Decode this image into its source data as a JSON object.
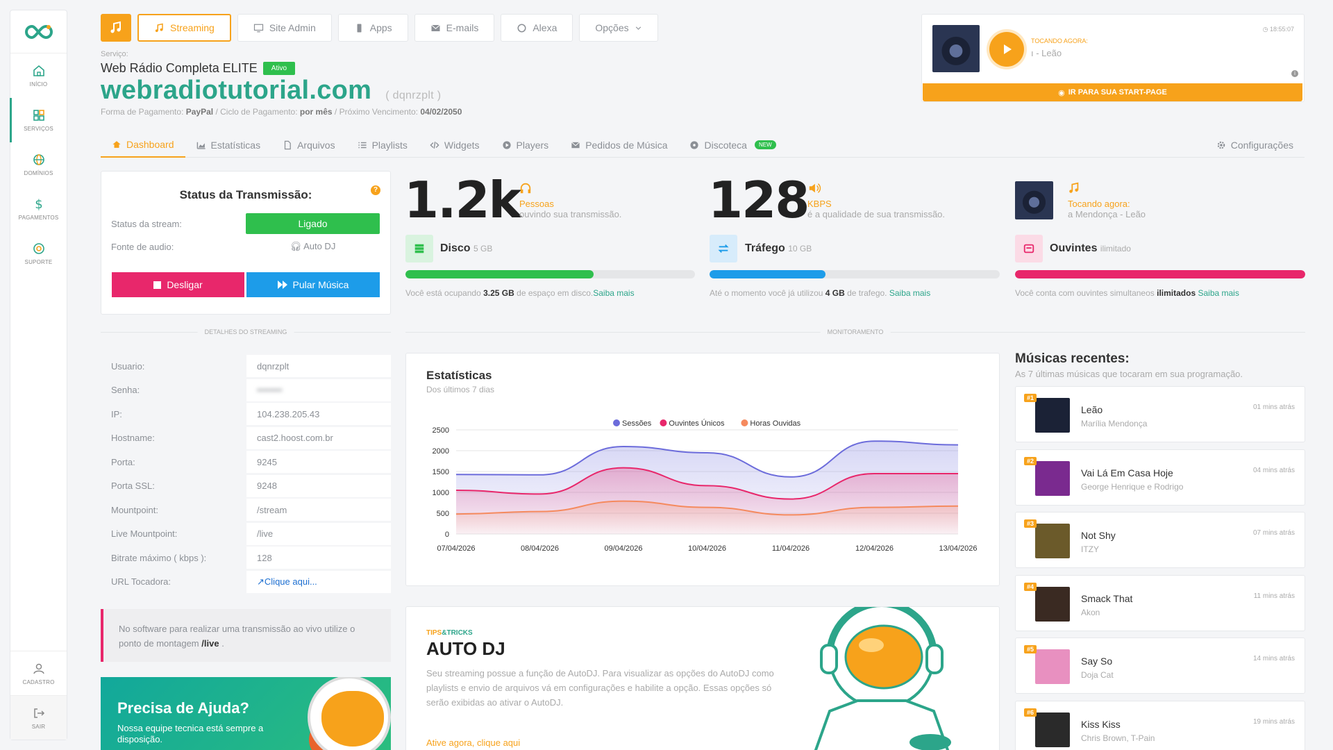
{
  "sidebar": {
    "items": [
      {
        "label": "Início",
        "icon": "home-icon"
      },
      {
        "label": "Serviços",
        "icon": "grid-icon"
      },
      {
        "label": "Domínios",
        "icon": "globe-icon"
      },
      {
        "label": "Pagamentos",
        "icon": "dollar-icon"
      },
      {
        "label": "Suporte",
        "icon": "support-icon"
      }
    ],
    "bottom": [
      {
        "label": "Cadastro",
        "icon": "user-icon"
      },
      {
        "label": "Sair",
        "icon": "logout-icon"
      }
    ]
  },
  "topnav": {
    "streaming": "Streaming",
    "site_admin": "Site Admin",
    "apps": "Apps",
    "emails": "E-mails",
    "alexa": "Alexa",
    "opcoes": "Opções"
  },
  "service": {
    "label": "Serviço:",
    "plan": "Web Rádio Completa ELITE",
    "status": "Ativo",
    "domain": "webradiotutorial.com",
    "user": "( dqnrzplt )",
    "pay_label": "Forma de Pagamento:",
    "pay_method": "PayPal",
    "cycle_label": "/ Ciclo de Pagamento:",
    "cycle": "por mês",
    "due_label": "/ Próximo Vencimento:",
    "due": "04/02/2050"
  },
  "now_playing_box": {
    "title": "Tocando agora:",
    "song": "ı - Leão",
    "time": "18:55:07",
    "cta": "Ir para sua Start-Page"
  },
  "tabs": {
    "dashboard": "Dashboard",
    "estatisticas": "Estatísticas",
    "arquivos": "Arquivos",
    "playlists": "Playlists",
    "widgets": "Widgets",
    "players": "Players",
    "pedidos": "Pedidos de Música",
    "discoteca": "Discoteca",
    "new_badge": "NEW",
    "config": "Configurações"
  },
  "status": {
    "title": "Status da Transmissão:",
    "stream_label": "Status da stream:",
    "stream_value": "Ligado",
    "source_label": "Fonte de audio:",
    "source_value": "Auto DJ",
    "off_button": "Desligar",
    "skip_button": "Pular Música"
  },
  "stats": {
    "listeners_value": "1.2k",
    "listeners_label": "Pessoas",
    "listeners_desc": "ouvindo sua transmissão.",
    "bitrate_value": "128",
    "bitrate_label": "KBPS",
    "bitrate_desc": "é a qualidade de sua transmissão.",
    "playing_label": "Tocando agora:",
    "playing_desc": "a Mendonça - Leão"
  },
  "resources": {
    "disk": {
      "title": "Disco",
      "limit": "5 GB",
      "fill": 0.65,
      "note_pre": "Você está ocupando",
      "note_val": "3.25 GB",
      "note_post": "de espaço em disco.",
      "link": "Saiba mais",
      "color": "#2fbf4d"
    },
    "traffic": {
      "title": "Tráfego",
      "limit": "10 GB",
      "fill": 0.4,
      "note_pre": "Até o momento você já utilizou",
      "note_val": "4 GB",
      "note_post": "de trafego.",
      "link": "Saiba mais",
      "color": "#1d9ce9"
    },
    "listeners": {
      "title": "Ouvintes",
      "limit": "ilimitado",
      "fill": 1.0,
      "note_pre": "Você conta com ouvintes simultaneos",
      "note_val": "ilimitados",
      "note_post": "",
      "link": "Saiba mais",
      "color": "#e8276b"
    }
  },
  "dividers": {
    "details": "Detalhes do Streaming",
    "monitor": "Monitoramento"
  },
  "details": [
    {
      "key": "Usuario:",
      "value": "dqnrzplt"
    },
    {
      "key": "Senha:",
      "value": "••••••••"
    },
    {
      "key": "IP:",
      "value": "104.238.205.43"
    },
    {
      "key": "Hostname:",
      "value": "cast2.hoost.com.br"
    },
    {
      "key": "Porta:",
      "value": "9245"
    },
    {
      "key": "Porta SSL:",
      "value": "9248"
    },
    {
      "key": "Mountpoint:",
      "value": "/stream"
    },
    {
      "key": "Live Mountpoint:",
      "value": "/live"
    },
    {
      "key": "Bitrate máximo ( kbps ):",
      "value": "128"
    },
    {
      "key": "URL Tocadora:",
      "value": "Clique aqui..."
    }
  ],
  "note": {
    "text": "No software para realizar uma transmissão ao vivo utilize o ponto de montagem",
    "mount": "/live",
    "end": "."
  },
  "help": {
    "title": "Precisa de Ajuda?",
    "text": "Nossa equipe tecnica está sempre a disposição."
  },
  "chart_data": {
    "type": "area",
    "title": "Estatísticas",
    "subtitle": "Dos últimos 7 dias",
    "x": [
      "07/04/2026",
      "08/04/2026",
      "09/04/2026",
      "10/04/2026",
      "11/04/2026",
      "12/04/2026",
      "13/04/2026"
    ],
    "ylim": [
      0,
      2500
    ],
    "yticks": [
      0,
      500,
      1000,
      1500,
      2000,
      2500
    ],
    "legend": "top-center",
    "series": [
      {
        "name": "Sessões",
        "color": "#6c6cdb",
        "values": [
          1430,
          1420,
          2100,
          1950,
          1370,
          2230,
          2140
        ]
      },
      {
        "name": "Ouvintes Únicos",
        "color": "#e8276b",
        "values": [
          1050,
          960,
          1590,
          1160,
          840,
          1450,
          1450
        ]
      },
      {
        "name": "Horas Ouvidas",
        "color": "#f58a5e",
        "values": [
          480,
          540,
          790,
          640,
          460,
          640,
          670
        ]
      }
    ]
  },
  "autodj": {
    "tips": "TIPS",
    "tricks": "&TRICKS",
    "title": "AUTO DJ",
    "text": "Seu streaming possue a função de AutoDJ. Para visualizar as opções do AutoDJ como playlists e envio de arquivos vá em configurações e habilite a opção. Essas opções só serão exibidas ao ativar o AutoDJ.",
    "link": "Ative agora, clique aqui"
  },
  "recent": {
    "title": "Músicas recentes:",
    "subtitle": "As 7 últimas músicas que tocaram em sua programação.",
    "songs": [
      {
        "rank": "#1",
        "name": "Leão",
        "artist": "Marília Mendonça",
        "ago": "01 mins atrás",
        "color": "#1b2236"
      },
      {
        "rank": "#2",
        "name": "Vai Lá Em Casa Hoje",
        "artist": "George Henrique e Rodrigo",
        "ago": "04 mins atrás",
        "color": "#7a2a8f"
      },
      {
        "rank": "#3",
        "name": "Not Shy",
        "artist": "ITZY",
        "ago": "07 mins atrás",
        "color": "#6b5a2a"
      },
      {
        "rank": "#4",
        "name": "Smack That",
        "artist": "Akon",
        "ago": "11 mins atrás",
        "color": "#3a2a22"
      },
      {
        "rank": "#5",
        "name": "Say So",
        "artist": "Doja Cat",
        "ago": "14 mins atrás",
        "color": "#e890c0"
      },
      {
        "rank": "#6",
        "name": "Kiss Kiss",
        "artist": "Chris Brown, T-Pain",
        "ago": "19 mins atrás",
        "color": "#2a2a2a"
      }
    ]
  }
}
